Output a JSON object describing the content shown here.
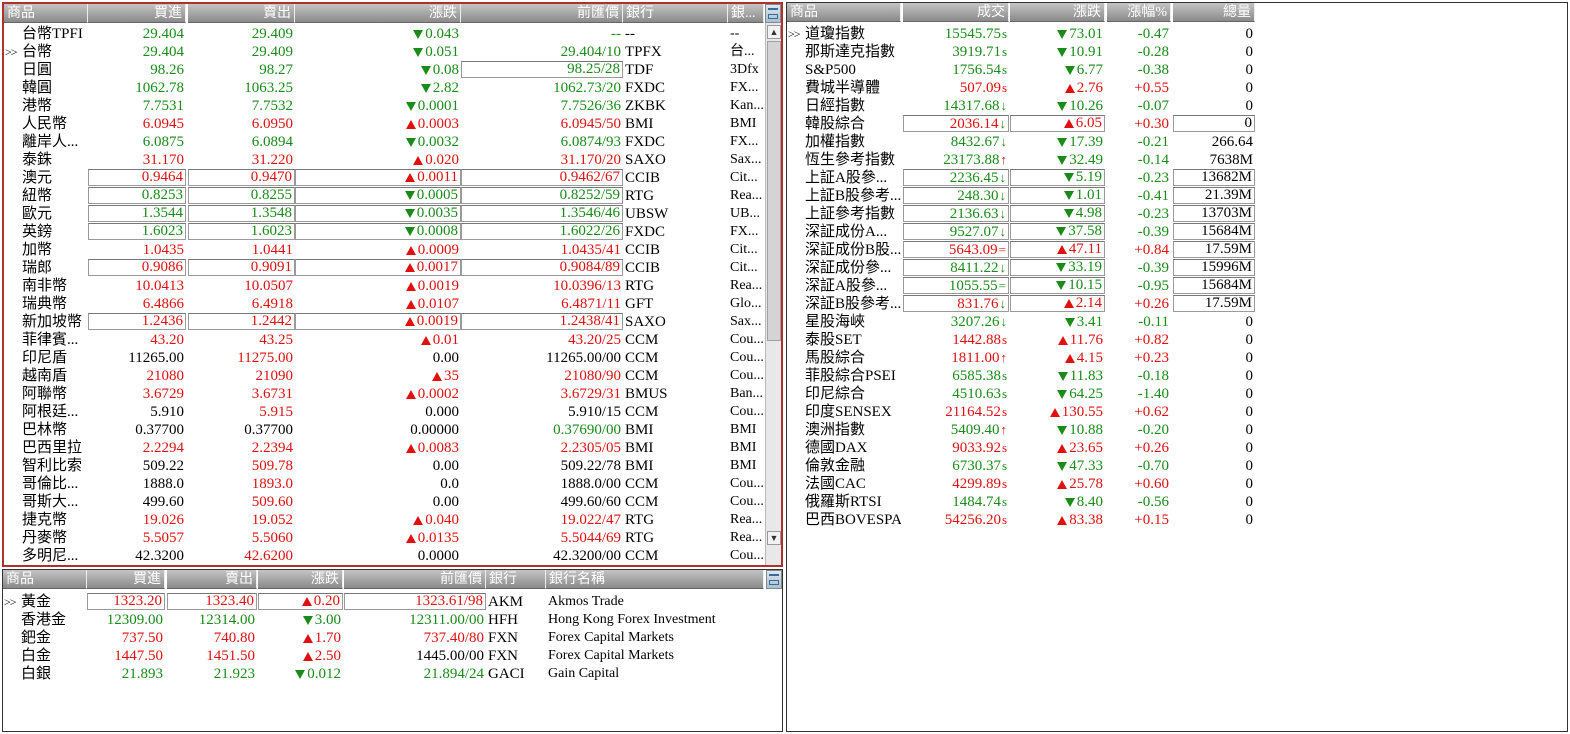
{
  "fx": {
    "headers": [
      "商品",
      "買進",
      "賣出",
      "漲跌",
      "前匯價",
      "銀行",
      "銀..."
    ],
    "rows": [
      {
        "name": "台幣TPFI",
        "bid": "29.404",
        "ask": "29.409",
        "dir": "down",
        "chg": "0.043",
        "prev": "--",
        "bank": "--",
        "bank_full": "--",
        "color": "g"
      },
      {
        "name": "台幣",
        "ptr": ">>",
        "bid": "29.404",
        "ask": "29.409",
        "dir": "down",
        "chg": "0.051",
        "prev": "29.404/10",
        "bank": "TPFX",
        "bank_full": "台...",
        "color": "g"
      },
      {
        "name": "日圓",
        "bid": "98.26",
        "ask": "98.27",
        "dir": "down",
        "chg": "0.08",
        "prev": "98.25/28",
        "bank": "TDF",
        "bank_full": "3Dfx",
        "color": "g",
        "boxprev": true
      },
      {
        "name": "韓圓",
        "bid": "1062.78",
        "ask": "1063.25",
        "dir": "down",
        "chg": "2.82",
        "prev": "1062.73/20",
        "bank": "FXDC",
        "bank_full": "FX...",
        "color": "g"
      },
      {
        "name": "港幣",
        "bid": "7.7531",
        "ask": "7.7532",
        "dir": "down",
        "chg": "0.0001",
        "prev": "7.7526/36",
        "bank": "ZKBK",
        "bank_full": "Kan...",
        "color": "g"
      },
      {
        "name": "人民幣",
        "bid": "6.0945",
        "ask": "6.0950",
        "dir": "up",
        "chg": "0.0003",
        "prev": "6.0945/50",
        "bank": "BMI",
        "bank_full": "BMI",
        "color": "rd"
      },
      {
        "name": "離岸人...",
        "bid": "6.0875",
        "ask": "6.0894",
        "dir": "down",
        "chg": "0.0032",
        "prev": "6.0874/93",
        "bank": "FXDC",
        "bank_full": "FX...",
        "color": "g"
      },
      {
        "name": "泰銖",
        "bid": "31.170",
        "ask": "31.220",
        "dir": "up",
        "chg": "0.020",
        "prev": "31.170/20",
        "bank": "SAXO",
        "bank_full": "Sax...",
        "color": "rd"
      },
      {
        "name": "澳元",
        "bid": "0.9464",
        "ask": "0.9470",
        "dir": "up",
        "chg": "0.0011",
        "prev": "0.9462/67",
        "bank": "CCIB",
        "bank_full": "Cit...",
        "color": "rd",
        "boxall": true
      },
      {
        "name": "紐幣",
        "bid": "0.8253",
        "ask": "0.8255",
        "dir": "down",
        "chg": "0.0005",
        "prev": "0.8252/59",
        "bank": "RTG",
        "bank_full": "Rea...",
        "color": "g",
        "boxall": true
      },
      {
        "name": "歐元",
        "bid": "1.3544",
        "ask": "1.3548",
        "dir": "down",
        "chg": "0.0035",
        "prev": "1.3546/46",
        "bank": "UBSW",
        "bank_full": "UB...",
        "color": "g",
        "boxall": true
      },
      {
        "name": "英鎊",
        "bid": "1.6023",
        "ask": "1.6023",
        "dir": "down",
        "chg": "0.0008",
        "prev": "1.6022/26",
        "bank": "FXDC",
        "bank_full": "FX...",
        "color": "g",
        "boxall": true
      },
      {
        "name": "加幣",
        "bid": "1.0435",
        "ask": "1.0441",
        "dir": "up",
        "chg": "0.0009",
        "prev": "1.0435/41",
        "bank": "CCIB",
        "bank_full": "Cit...",
        "color": "rd"
      },
      {
        "name": "瑞郎",
        "bid": "0.9086",
        "ask": "0.9091",
        "dir": "up",
        "chg": "0.0017",
        "prev": "0.9084/89",
        "bank": "CCIB",
        "bank_full": "Cit...",
        "color": "rd",
        "boxall": true
      },
      {
        "name": "南非幣",
        "bid": "10.0413",
        "ask": "10.0507",
        "dir": "up",
        "chg": "0.0019",
        "prev": "10.0396/13",
        "bank": "RTG",
        "bank_full": "Rea...",
        "color": "rd"
      },
      {
        "name": "瑞典幣",
        "bid": "6.4866",
        "ask": "6.4918",
        "dir": "up",
        "chg": "0.0107",
        "prev": "6.4871/11",
        "bank": "GFT",
        "bank_full": "Glo...",
        "color": "rd"
      },
      {
        "name": "新加坡幣",
        "bid": "1.2436",
        "ask": "1.2442",
        "dir": "up",
        "chg": "0.0019",
        "prev": "1.2438/41",
        "bank": "SAXO",
        "bank_full": "Sax...",
        "color": "rd",
        "boxall": true
      },
      {
        "name": "菲律賓...",
        "bid": "43.20",
        "ask": "43.25",
        "dir": "up",
        "chg": "0.01",
        "prev": "43.20/25",
        "bank": "CCM",
        "bank_full": "Cou...",
        "color": "rd"
      },
      {
        "name": "印尼盾",
        "bid": "11265.00",
        "ask": "11275.00",
        "dir": "none",
        "chg": "0.00",
        "prev": "11265.00/00",
        "bank": "CCM",
        "bank_full": "Cou...",
        "color": "k",
        "askcolor": "rd"
      },
      {
        "name": "越南盾",
        "bid": "21080",
        "ask": "21090",
        "dir": "up",
        "chg": "35",
        "prev": "21080/90",
        "bank": "CCM",
        "bank_full": "Cou...",
        "color": "rd"
      },
      {
        "name": "阿聯幣",
        "bid": "3.6729",
        "ask": "3.6731",
        "dir": "up",
        "chg": "0.0002",
        "prev": "3.6729/31",
        "bank": "BMUS",
        "bank_full": "Ban...",
        "color": "rd"
      },
      {
        "name": "阿根廷...",
        "bid": "5.910",
        "ask": "5.915",
        "dir": "none",
        "chg": "0.000",
        "prev": "5.910/15",
        "bank": "CCM",
        "bank_full": "Cou...",
        "color": "k",
        "askcolor": "rd"
      },
      {
        "name": "巴林幣",
        "bid": "0.37700",
        "ask": "0.37700",
        "dir": "none",
        "chg": "0.00000",
        "prev": "0.37690/00",
        "bank": "BMI",
        "bank_full": "BMI",
        "color": "k",
        "prevcolor": "g"
      },
      {
        "name": "巴西里拉",
        "bid": "2.2294",
        "ask": "2.2394",
        "dir": "up",
        "chg": "0.0083",
        "prev": "2.2305/05",
        "bank": "BMI",
        "bank_full": "BMI",
        "color": "rd"
      },
      {
        "name": "智利比索",
        "bid": "509.22",
        "ask": "509.78",
        "dir": "none",
        "chg": "0.00",
        "prev": "509.22/78",
        "bank": "BMI",
        "bank_full": "BMI",
        "color": "k",
        "askcolor": "rd"
      },
      {
        "name": "哥倫比...",
        "bid": "1888.0",
        "ask": "1893.0",
        "dir": "none",
        "chg": "0.0",
        "prev": "1888.0/00",
        "bank": "CCM",
        "bank_full": "Cou...",
        "color": "k",
        "askcolor": "rd"
      },
      {
        "name": "哥斯大...",
        "bid": "499.60",
        "ask": "509.60",
        "dir": "none",
        "chg": "0.00",
        "prev": "499.60/60",
        "bank": "CCM",
        "bank_full": "Cou...",
        "color": "k",
        "askcolor": "rd"
      },
      {
        "name": "捷克幣",
        "bid": "19.026",
        "ask": "19.052",
        "dir": "up",
        "chg": "0.040",
        "prev": "19.022/47",
        "bank": "RTG",
        "bank_full": "Rea...",
        "color": "rd"
      },
      {
        "name": "丹麥幣",
        "bid": "5.5057",
        "ask": "5.5060",
        "dir": "up",
        "chg": "0.0135",
        "prev": "5.5044/69",
        "bank": "RTG",
        "bank_full": "Rea...",
        "color": "rd"
      },
      {
        "name": "多明尼...",
        "bid": "42.3200",
        "ask": "42.6200",
        "dir": "none",
        "chg": "0.0000",
        "prev": "42.3200/00",
        "bank": "CCM",
        "bank_full": "Cou...",
        "color": "k",
        "askcolor": "rd"
      }
    ]
  },
  "metals": {
    "headers": [
      "商品",
      "買進",
      "賣出",
      "漲跌",
      "前匯價",
      "銀行",
      "銀行名稱"
    ],
    "rows": [
      {
        "name": "黃金",
        "ptr": ">>",
        "bid": "1323.20",
        "ask": "1323.40",
        "dir": "up",
        "chg": "0.20",
        "prev": "1323.61/98",
        "bank": "AKM",
        "bank_full": "Akmos Trade",
        "color": "rd",
        "boxall": true
      },
      {
        "name": "香港金",
        "bid": "12309.00",
        "ask": "12314.00",
        "dir": "down",
        "chg": "3.00",
        "prev": "12311.00/00",
        "bank": "HFH",
        "bank_full": "Hong Kong Forex Investment",
        "color": "g"
      },
      {
        "name": "鈀金",
        "bid": "737.50",
        "ask": "740.80",
        "dir": "up",
        "chg": "1.70",
        "prev": "737.40/80",
        "bank": "FXN",
        "bank_full": "Forex Capital Markets",
        "color": "rd"
      },
      {
        "name": "白金",
        "bid": "1447.50",
        "ask": "1451.50",
        "dir": "up",
        "chg": "2.50",
        "prev": "1445.00/00",
        "bank": "FXN",
        "bank_full": "Forex Capital Markets",
        "color": "rd",
        "prevcolor": "k"
      },
      {
        "name": "白銀",
        "bid": "21.893",
        "ask": "21.923",
        "dir": "down",
        "chg": "0.012",
        "prev": "21.894/24",
        "bank": "GACI",
        "bank_full": "Gain Capital",
        "color": "g"
      }
    ]
  },
  "indices": {
    "headers": [
      "商品",
      "成交",
      "漲跌",
      "漲幅%",
      "總量"
    ],
    "rows": [
      {
        "name": "道瓊指數",
        "ptr": ">>",
        "price": "15545.75",
        "sfx": "s",
        "dir": "down",
        "chg": "73.01",
        "pct": "-0.47",
        "vol": "0",
        "color": "g"
      },
      {
        "name": "那斯達克指數",
        "price": "3919.71",
        "sfx": "s",
        "dir": "down",
        "chg": "10.91",
        "pct": "-0.28",
        "vol": "0",
        "color": "g"
      },
      {
        "name": "S&P500",
        "price": "1756.54",
        "sfx": "s",
        "dir": "down",
        "chg": "6.77",
        "pct": "-0.38",
        "vol": "0",
        "color": "g"
      },
      {
        "name": "費城半導體",
        "price": "507.09",
        "sfx": "s",
        "dir": "up",
        "chg": "2.76",
        "pct": "+0.55",
        "vol": "0",
        "color": "rd"
      },
      {
        "name": "日經指數",
        "price": "14317.68",
        "sfx": "↓",
        "dir": "down",
        "chg": "10.26",
        "pct": "-0.07",
        "vol": "0",
        "color": "g"
      },
      {
        "name": "韓股綜合",
        "price": "2036.14",
        "sfx": "↓",
        "dir": "up",
        "chg": "6.05",
        "pct": "+0.30",
        "vol": "0",
        "color": "rd",
        "pricecolor": "rd",
        "boxall": true
      },
      {
        "name": "加權指數",
        "price": "8432.67",
        "sfx": "↓",
        "dir": "down",
        "chg": "17.39",
        "pct": "-0.21",
        "vol": "266.64",
        "color": "g"
      },
      {
        "name": "恆生參考指數",
        "price": "23173.88",
        "sfx": "↑",
        "dir": "down",
        "chg": "32.49",
        "pct": "-0.14",
        "vol": "7638M",
        "color": "g"
      },
      {
        "name": "上証A股參...",
        "price": "2236.45",
        "sfx": "↓",
        "dir": "down",
        "chg": "5.19",
        "pct": "-0.23",
        "vol": "13682M",
        "color": "g",
        "boxall": true
      },
      {
        "name": "上証B股參考...",
        "price": "248.30",
        "sfx": "↓",
        "dir": "down",
        "chg": "1.01",
        "pct": "-0.41",
        "vol": "21.39M",
        "color": "g",
        "boxall": true
      },
      {
        "name": "上証參考指數",
        "price": "2136.63",
        "sfx": "↓",
        "dir": "down",
        "chg": "4.98",
        "pct": "-0.23",
        "vol": "13703M",
        "color": "g",
        "boxall": true
      },
      {
        "name": "深証成份A...",
        "price": "9527.07",
        "sfx": "↓",
        "dir": "down",
        "chg": "37.58",
        "pct": "-0.39",
        "vol": "15684M",
        "color": "g",
        "boxall": true
      },
      {
        "name": "深証成份B股...",
        "price": "5643.09",
        "sfx": "=",
        "dir": "up",
        "chg": "47.11",
        "pct": "+0.84",
        "vol": "17.59M",
        "color": "rd",
        "boxall": true
      },
      {
        "name": "深証成份參...",
        "price": "8411.22",
        "sfx": "↓",
        "dir": "down",
        "chg": "33.19",
        "pct": "-0.39",
        "vol": "15996M",
        "color": "g",
        "boxall": true
      },
      {
        "name": "深証A股參...",
        "price": "1055.55",
        "sfx": "=",
        "dir": "down",
        "chg": "10.15",
        "pct": "-0.95",
        "vol": "15684M",
        "color": "g",
        "boxall": true
      },
      {
        "name": "深証B股參考...",
        "price": "831.76",
        "sfx": "↓",
        "dir": "up",
        "chg": "2.14",
        "pct": "+0.26",
        "vol": "17.59M",
        "color": "rd",
        "boxall": true
      },
      {
        "name": "星股海峽",
        "price": "3207.26",
        "sfx": "↓",
        "dir": "down",
        "chg": "3.41",
        "pct": "-0.11",
        "vol": "0",
        "color": "g"
      },
      {
        "name": "泰股SET",
        "price": "1442.88",
        "sfx": "s",
        "dir": "up",
        "chg": "11.76",
        "pct": "+0.82",
        "vol": "0",
        "color": "rd"
      },
      {
        "name": "馬股綜合",
        "price": "1811.00",
        "sfx": "↑",
        "dir": "up",
        "chg": "4.15",
        "pct": "+0.23",
        "vol": "0",
        "color": "rd"
      },
      {
        "name": "菲股綜合PSEI",
        "price": "6585.38",
        "sfx": "s",
        "dir": "down",
        "chg": "11.83",
        "pct": "-0.18",
        "vol": "0",
        "color": "g"
      },
      {
        "name": "印尼綜合",
        "price": "4510.63",
        "sfx": "s",
        "dir": "down",
        "chg": "64.25",
        "pct": "-1.40",
        "vol": "0",
        "color": "g"
      },
      {
        "name": "印度SENSEX",
        "price": "21164.52",
        "sfx": "s",
        "dir": "up",
        "chg": "130.55",
        "pct": "+0.62",
        "vol": "0",
        "color": "rd"
      },
      {
        "name": "澳洲指數",
        "price": "5409.40",
        "sfx": "↑",
        "dir": "down",
        "chg": "10.88",
        "pct": "-0.20",
        "vol": "0",
        "color": "g"
      },
      {
        "name": "德國DAX",
        "price": "9033.92",
        "sfx": "s",
        "dir": "up",
        "chg": "23.65",
        "pct": "+0.26",
        "vol": "0",
        "color": "rd"
      },
      {
        "name": "倫敦金融",
        "price": "6730.37",
        "sfx": "s",
        "dir": "down",
        "chg": "47.33",
        "pct": "-0.70",
        "vol": "0",
        "color": "g"
      },
      {
        "name": "法國CAC",
        "price": "4299.89",
        "sfx": "s",
        "dir": "up",
        "chg": "25.78",
        "pct": "+0.60",
        "vol": "0",
        "color": "rd"
      },
      {
        "name": "俄羅斯RTSI",
        "price": "1484.74",
        "sfx": "s",
        "dir": "down",
        "chg": "8.40",
        "pct": "-0.56",
        "vol": "0",
        "color": "g"
      },
      {
        "name": "巴西BOVESPA",
        "price": "54256.20",
        "sfx": "s",
        "dir": "up",
        "chg": "83.38",
        "pct": "+0.15",
        "vol": "0",
        "color": "rd"
      }
    ]
  },
  "scroll": {
    "up_icon": "▲",
    "down_icon": "▼"
  },
  "colors": {
    "up": "#e01010",
    "down": "#1a8a1a",
    "header_top": "#c4c4c4",
    "header_bottom": "#8a8a8a",
    "active_border": "#b03030"
  }
}
